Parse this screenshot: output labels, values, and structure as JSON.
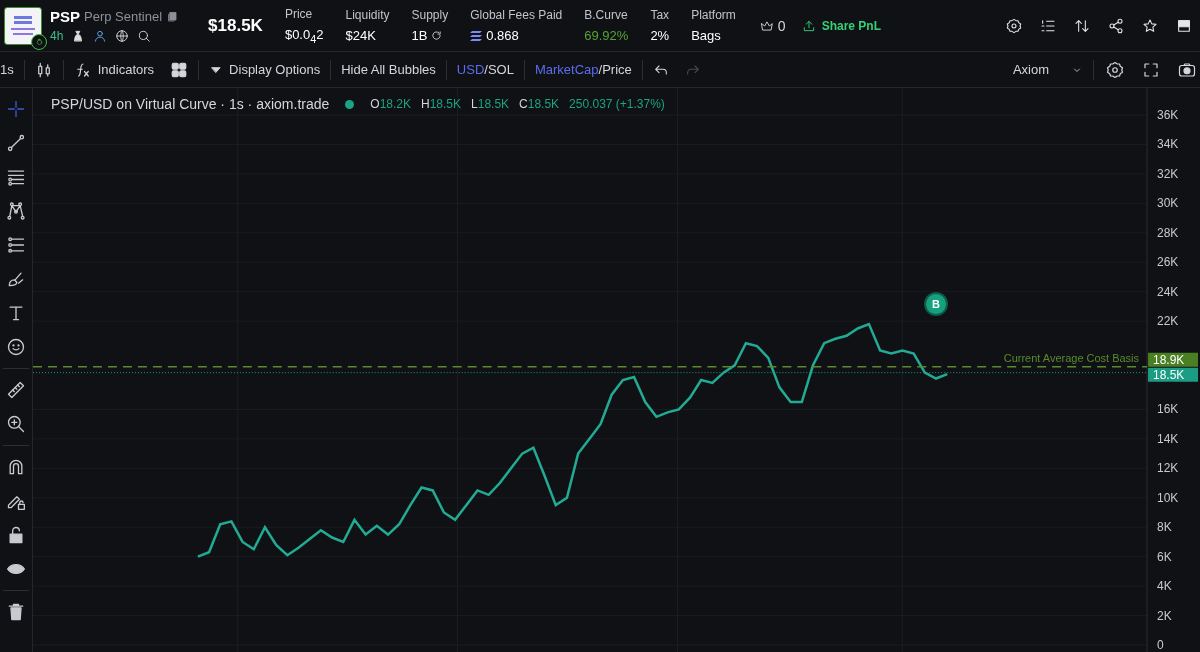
{
  "header": {
    "token": {
      "symbol": "PSP",
      "name": "Perp Sentinel",
      "age": "4h"
    },
    "market_cap": "$18.5K",
    "stats": [
      {
        "label": "Price",
        "value": "$0.0$_{4}$2",
        "kind": "plain"
      },
      {
        "label": "Liquidity",
        "value": "$24K",
        "kind": "plain"
      },
      {
        "label": "Supply",
        "value": "1B",
        "kind": "refresh"
      },
      {
        "label": "Global Fees Paid",
        "value": "0.868",
        "kind": "sol"
      },
      {
        "label": "B.Curve",
        "value": "69.92%",
        "kind": "plain",
        "color": "#52a532"
      },
      {
        "label": "Tax",
        "value": "2%",
        "kind": "plain"
      },
      {
        "label": "Platform",
        "value": "Bags",
        "kind": "plain"
      }
    ],
    "crown_count": "0",
    "share_button": "Share PnL"
  },
  "toolbar": {
    "interval": "1s",
    "indicators": "Indicators",
    "display_options": "Display Options",
    "hide_bubbles": "Hide All Bubbles",
    "currency_toggle": {
      "separator": "/",
      "options": [
        {
          "label": "USD",
          "selected": true
        },
        {
          "label": "SOL",
          "selected": false
        }
      ]
    },
    "metric_toggle": {
      "separator": "/",
      "options": [
        {
          "label": "MarketCap",
          "selected": true
        },
        {
          "label": "Price",
          "selected": false
        }
      ]
    },
    "redo_disabled": true,
    "layout_menu": "Axiom"
  },
  "tools": [
    {
      "kind": "crosshair",
      "selected": true
    },
    {
      "kind": "trendline",
      "selected": false
    },
    {
      "kind": "fib",
      "selected": false
    },
    {
      "kind": "pattern",
      "selected": false
    },
    {
      "kind": "projection",
      "selected": false
    },
    {
      "kind": "brush",
      "selected": false
    },
    {
      "kind": "text",
      "selected": false
    },
    {
      "kind": "emoji",
      "selected": false
    },
    {
      "kind": "divider"
    },
    {
      "kind": "ruler",
      "selected": false
    },
    {
      "kind": "zoom",
      "selected": false
    },
    {
      "kind": "divider"
    },
    {
      "kind": "magnet",
      "selected": false
    },
    {
      "kind": "lockdraw",
      "selected": false
    },
    {
      "kind": "lock",
      "selected": false
    },
    {
      "kind": "eye",
      "selected": false
    },
    {
      "kind": "divider"
    },
    {
      "kind": "trash",
      "selected": false
    }
  ],
  "chart": {
    "legend": {
      "title": "PSP/USD on Virtual Curve · 1s · axiom.trade",
      "ohlc": [
        {
          "key": "O",
          "value": "18.2K"
        },
        {
          "key": "H",
          "value": "18.5K"
        },
        {
          "key": "L",
          "value": "18.5K"
        },
        {
          "key": "C",
          "value": "18.5K"
        }
      ],
      "change": "250.037 (+1.37%)"
    },
    "marker": "B",
    "price_tags": [
      {
        "text": "18.9K",
        "color": "#4b7f24"
      },
      {
        "text": "18.5K",
        "color": "#1a9d84"
      }
    ],
    "chart_data": {
      "type": "line",
      "ylim": [
        0,
        36000
      ],
      "grid": true,
      "ref_lines": [
        {
          "axis": "y",
          "value": 18900,
          "label": "Current Average Cost Basis",
          "color": "#5a8a2e"
        },
        {
          "axis": "y",
          "value": 18500,
          "color": "#1a9d84"
        }
      ],
      "yticks": [
        {
          "value": 0,
          "label": "0"
        },
        {
          "value": 2000,
          "label": "2K"
        },
        {
          "value": 4000,
          "label": "4K"
        },
        {
          "value": 6000,
          "label": "6K"
        },
        {
          "value": 8000,
          "label": "8K"
        },
        {
          "value": 10000,
          "label": "10K"
        },
        {
          "value": 12000,
          "label": "12K"
        },
        {
          "value": 14000,
          "label": "14K"
        },
        {
          "value": 16000,
          "label": "16K"
        },
        {
          "value": 22000,
          "label": "22K"
        },
        {
          "value": 24000,
          "label": "24K"
        },
        {
          "value": 26000,
          "label": "26K"
        },
        {
          "value": 28000,
          "label": "28K"
        },
        {
          "value": 30000,
          "label": "30K"
        },
        {
          "value": 32000,
          "label": "32K"
        },
        {
          "value": 34000,
          "label": "34K"
        },
        {
          "value": 36000,
          "label": "36K"
        }
      ],
      "series": [
        {
          "color": "#22ab94",
          "values": [
            6000,
            6300,
            8200,
            8400,
            7000,
            6500,
            8000,
            6800,
            6100,
            6600,
            7200,
            7800,
            7300,
            7000,
            8500,
            7500,
            8100,
            7500,
            8200,
            9500,
            10700,
            10500,
            9000,
            8500,
            9500,
            10500,
            10200,
            11000,
            12000,
            13000,
            13400,
            11500,
            9500,
            10000,
            13000,
            14000,
            15000,
            17000,
            18000,
            18200,
            16500,
            15500,
            15800,
            16000,
            16800,
            18000,
            17800,
            18500,
            19000,
            20500,
            20300,
            19500,
            17500,
            16500,
            16500,
            19000,
            20500,
            20800,
            21000,
            21500,
            21800,
            20000,
            19800,
            20000,
            19800,
            18500,
            18100,
            18400
          ]
        }
      ]
    }
  }
}
